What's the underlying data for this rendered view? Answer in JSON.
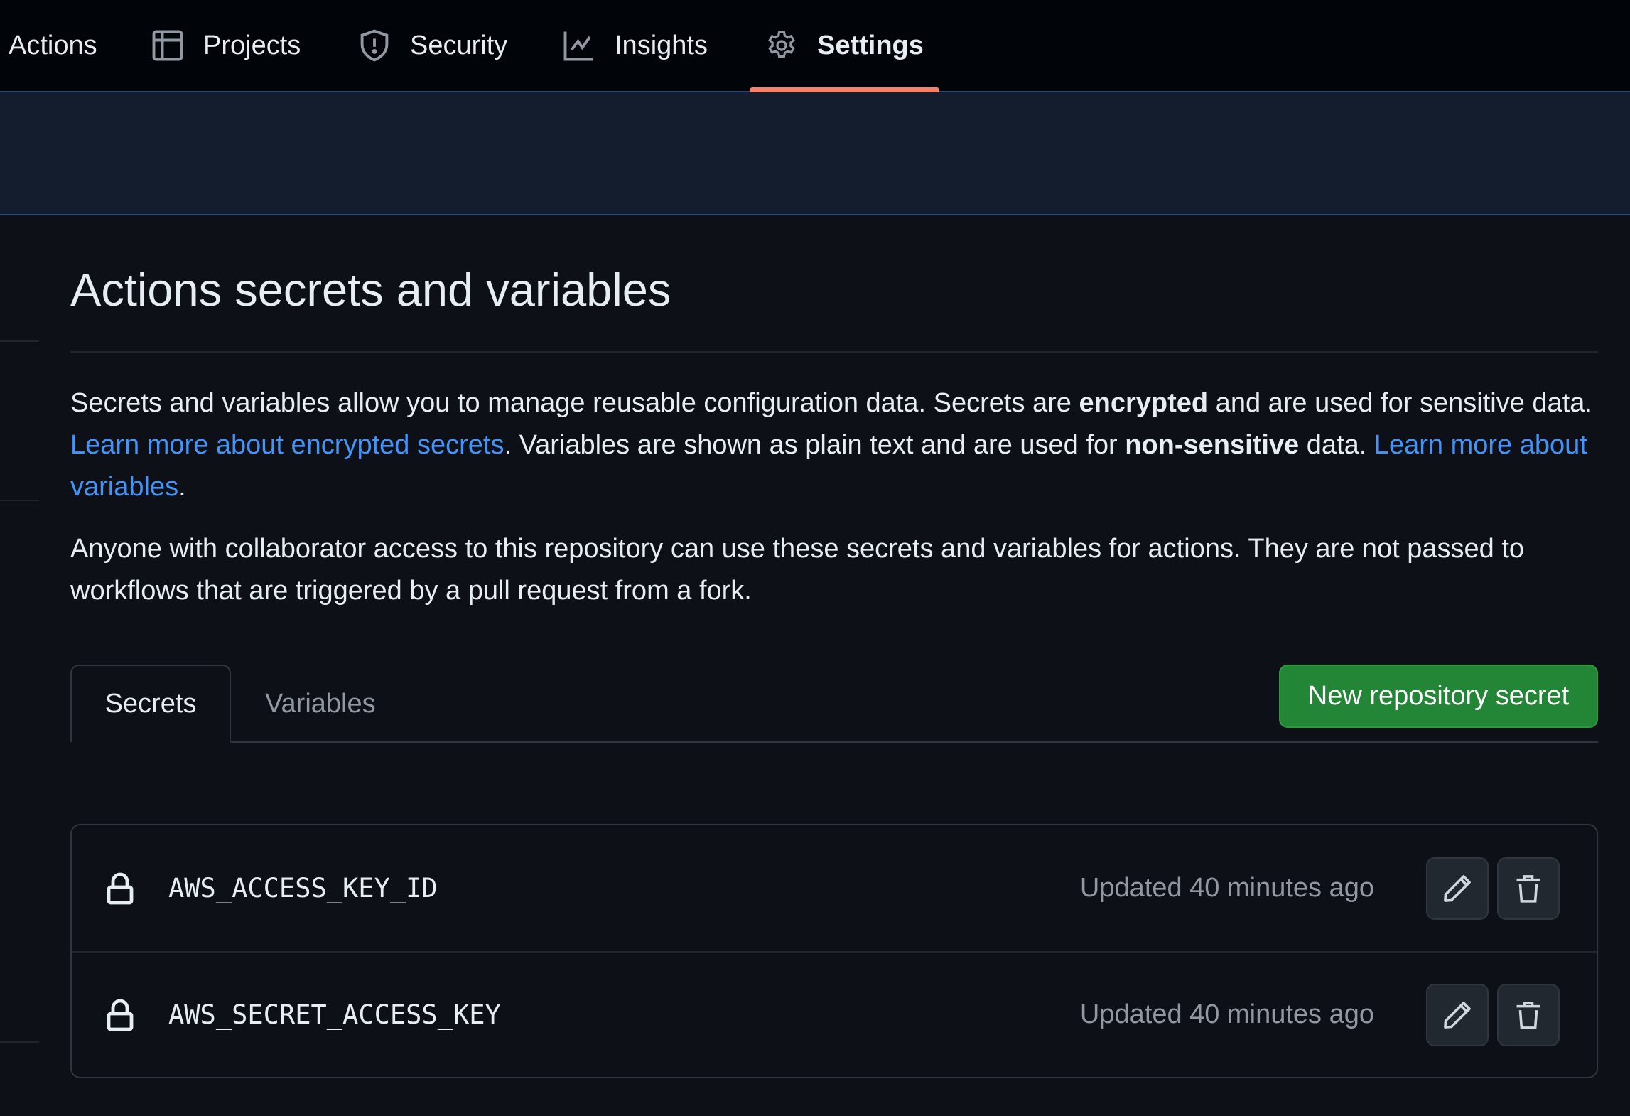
{
  "nav": {
    "items": [
      {
        "label": "Actions",
        "icon": "none"
      },
      {
        "label": "Projects",
        "icon": "table-icon"
      },
      {
        "label": "Security",
        "icon": "shield-icon"
      },
      {
        "label": "Insights",
        "icon": "graph-icon"
      },
      {
        "label": "Settings",
        "icon": "gear-icon",
        "active": true
      }
    ],
    "active_underline_color": "#f78166"
  },
  "page": {
    "title": "Actions secrets and variables",
    "intro": {
      "part1": "Secrets and variables allow you to manage reusable configuration data. Secrets are ",
      "bold1": "encrypted",
      "part2": " and are used for sensitive data. ",
      "link1": "Learn more about encrypted secrets",
      "part3": ". Variables are shown as plain text and are used for ",
      "bold2": "non-sensitive",
      "part4": " data. ",
      "link2": "Learn more about variables",
      "part5": "."
    },
    "note": "Anyone with collaborator access to this repository can use these secrets and variables for actions. They are not passed to workflows that are triggered by a pull request from a fork."
  },
  "tabs": [
    {
      "label": "Secrets",
      "active": true
    },
    {
      "label": "Variables",
      "active": false
    }
  ],
  "new_secret_button": {
    "label": "New repository secret",
    "color": "#238636"
  },
  "secrets": [
    {
      "name": "AWS_ACCESS_KEY_ID",
      "updated": "Updated 40 minutes ago"
    },
    {
      "name": "AWS_SECRET_ACCESS_KEY",
      "updated": "Updated 40 minutes ago"
    }
  ],
  "colors": {
    "background": "#0d1117",
    "nav_background": "#010409",
    "banner_background": "#131d2e",
    "link": "#4493f8",
    "muted_text": "#9198a1"
  }
}
